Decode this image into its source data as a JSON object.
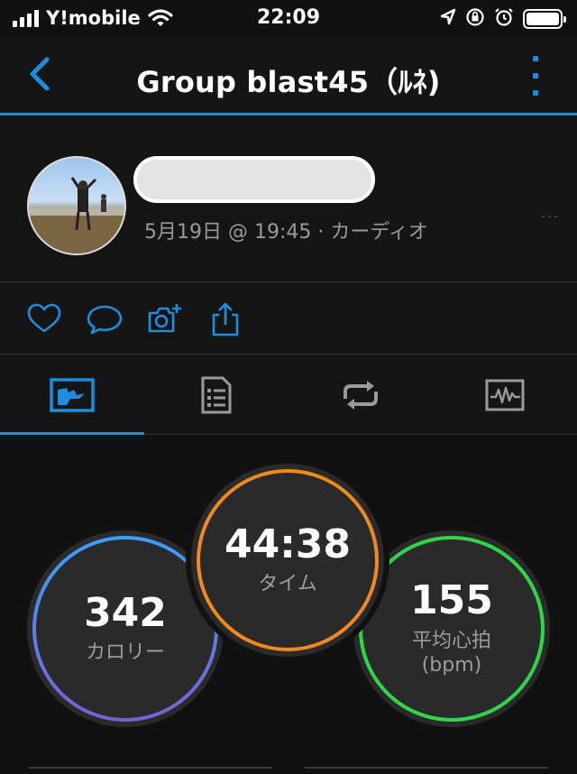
{
  "status_bar": {
    "carrier": "Y!mobile",
    "time": "22:09"
  },
  "nav": {
    "title": "Group blast45（ﾙﾈ)"
  },
  "profile": {
    "subtitle": "5月19日 @ 19:45 · カーディオ"
  },
  "actions": [
    {
      "icon": "heart-icon"
    },
    {
      "icon": "comment-icon"
    },
    {
      "icon": "add-photo-icon"
    },
    {
      "icon": "share-icon"
    }
  ],
  "tabs": [
    {
      "icon": "overview-icon",
      "active": true
    },
    {
      "icon": "details-list-icon",
      "active": false
    },
    {
      "icon": "laps-icon",
      "active": false
    },
    {
      "icon": "charts-icon",
      "active": false
    }
  ],
  "stats": {
    "calories": {
      "value": "342",
      "label": "カロリー"
    },
    "time": {
      "value": "44:38",
      "label": "タイム"
    },
    "heart_rate": {
      "value": "155",
      "label": "平均心拍\n(bpm)"
    }
  },
  "colors": {
    "accent": "#1b8ee0",
    "time_ring": "#f08a1c",
    "heart_ring": "#2fd64a",
    "calorie_ring_top": "#3aa0ff",
    "calorie_ring_bottom": "#7a5fd0"
  }
}
